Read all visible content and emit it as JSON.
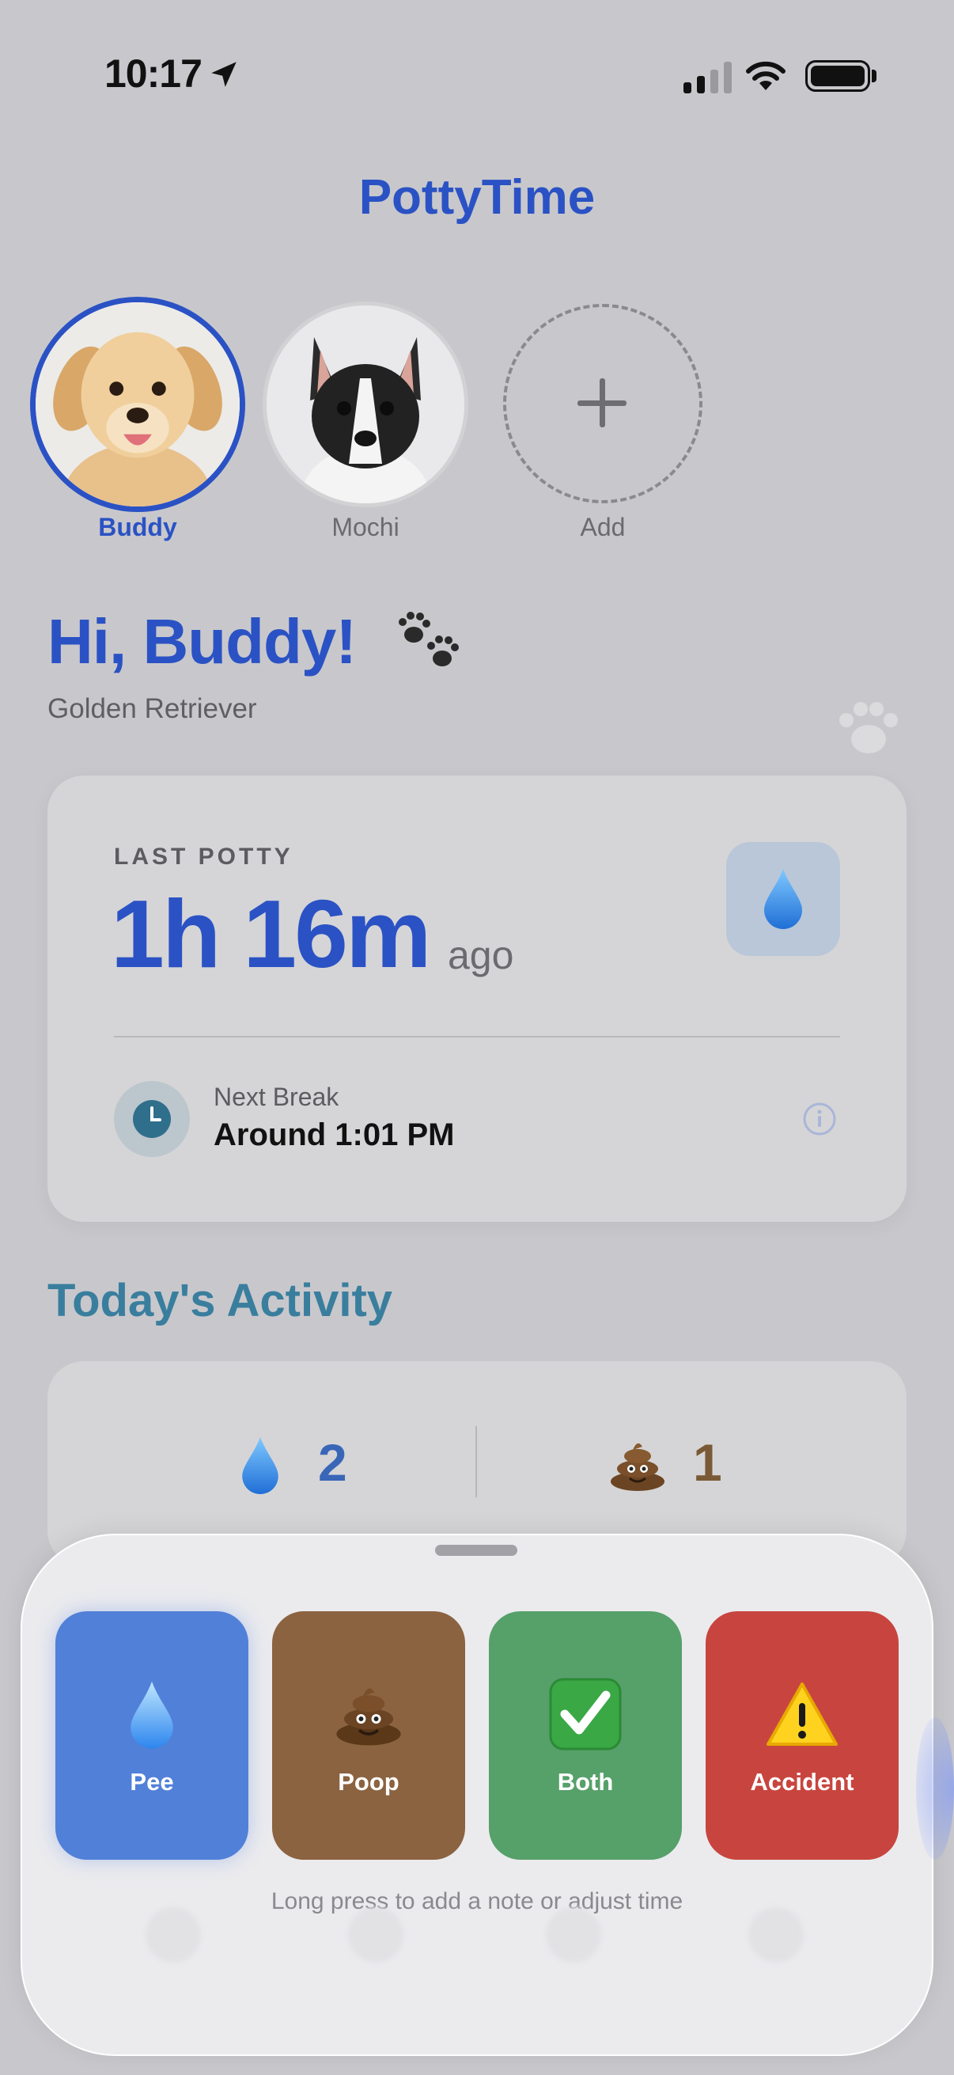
{
  "status_bar": {
    "time": "10:17"
  },
  "app": {
    "title": "PottyTime"
  },
  "pets": [
    {
      "name": "Buddy",
      "selected": true
    },
    {
      "name": "Mochi",
      "selected": false
    }
  ],
  "add_pet_label": "Add",
  "greeting": {
    "text": "Hi, Buddy!",
    "breed": "Golden Retriever"
  },
  "last_potty": {
    "label": "LAST POTTY",
    "value": "1h 16m",
    "suffix": "ago",
    "type_icon": "water-drop-icon"
  },
  "next_break": {
    "label": "Next Break",
    "value": "Around 1:01 PM"
  },
  "activity": {
    "title": "Today's Activity",
    "pee_count": "2",
    "poop_count": "1"
  },
  "actions": [
    {
      "label": "Pee",
      "icon": "water-drop-icon",
      "color": "#5180d8"
    },
    {
      "label": "Poop",
      "icon": "poop-icon",
      "color": "#8b6340"
    },
    {
      "label": "Both",
      "icon": "check-icon",
      "color": "#56a06a"
    },
    {
      "label": "Accident",
      "icon": "warning-icon",
      "color": "#c8453f"
    }
  ],
  "hint": "Long press to add a note or adjust time",
  "colors": {
    "primary": "#2b52c4",
    "accent_teal": "#3a7e9e"
  }
}
